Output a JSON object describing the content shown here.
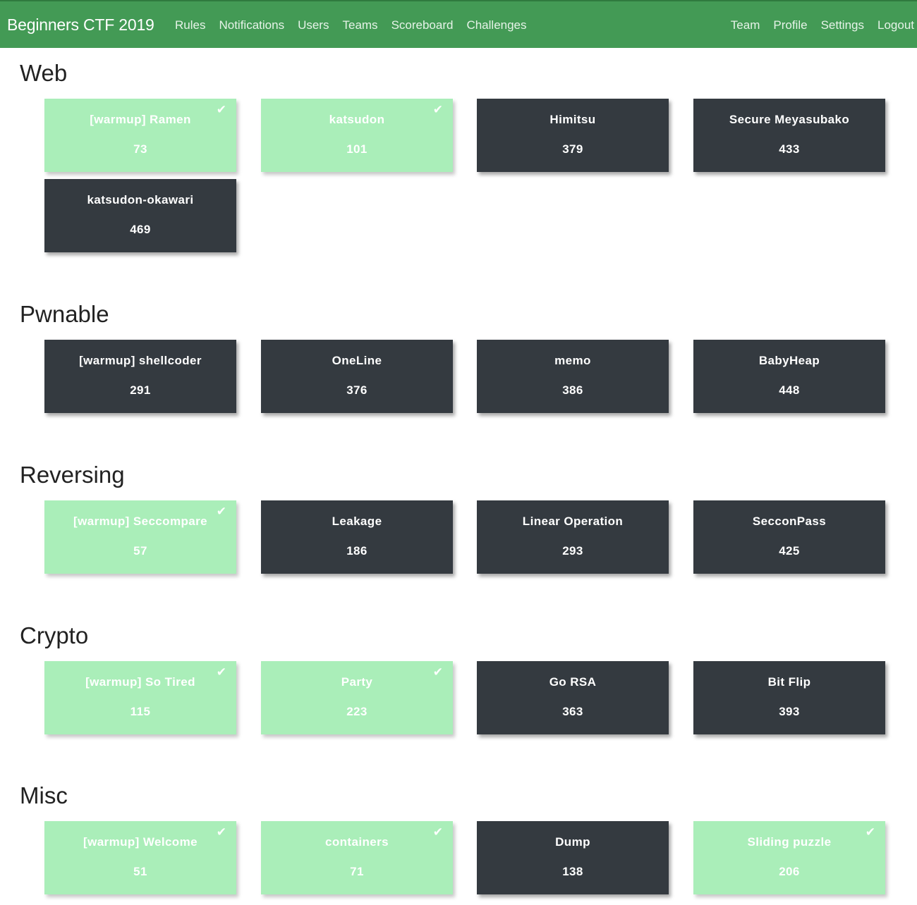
{
  "navbar": {
    "brand": "Beginners CTF 2019",
    "left_links": [
      "Rules",
      "Notifications",
      "Users",
      "Teams",
      "Scoreboard",
      "Challenges"
    ],
    "right_links": [
      "Team",
      "Profile",
      "Settings",
      "Logout"
    ]
  },
  "colors": {
    "navbar": "#439a55",
    "solved": "#aaeeb9",
    "unsolved": "#343a40"
  },
  "categories": [
    {
      "title": "Web",
      "challenges": [
        {
          "name": "[warmup] Ramen",
          "points": "73",
          "solved": true
        },
        {
          "name": "katsudon",
          "points": "101",
          "solved": true
        },
        {
          "name": "Himitsu",
          "points": "379",
          "solved": false
        },
        {
          "name": "Secure Meyasubako",
          "points": "433",
          "solved": false
        },
        {
          "name": "katsudon-okawari",
          "points": "469",
          "solved": false
        }
      ]
    },
    {
      "title": "Pwnable",
      "challenges": [
        {
          "name": "[warmup] shellcoder",
          "points": "291",
          "solved": false
        },
        {
          "name": "OneLine",
          "points": "376",
          "solved": false
        },
        {
          "name": "memo",
          "points": "386",
          "solved": false
        },
        {
          "name": "BabyHeap",
          "points": "448",
          "solved": false
        }
      ]
    },
    {
      "title": "Reversing",
      "challenges": [
        {
          "name": "[warmup] Seccompare",
          "points": "57",
          "solved": true
        },
        {
          "name": "Leakage",
          "points": "186",
          "solved": false
        },
        {
          "name": "Linear Operation",
          "points": "293",
          "solved": false
        },
        {
          "name": "SecconPass",
          "points": "425",
          "solved": false
        }
      ]
    },
    {
      "title": "Crypto",
      "challenges": [
        {
          "name": "[warmup] So Tired",
          "points": "115",
          "solved": true
        },
        {
          "name": "Party",
          "points": "223",
          "solved": true
        },
        {
          "name": "Go RSA",
          "points": "363",
          "solved": false
        },
        {
          "name": "Bit Flip",
          "points": "393",
          "solved": false
        }
      ]
    },
    {
      "title": "Misc",
      "challenges": [
        {
          "name": "[warmup] Welcome",
          "points": "51",
          "solved": true
        },
        {
          "name": "containers",
          "points": "71",
          "solved": true
        },
        {
          "name": "Dump",
          "points": "138",
          "solved": false
        },
        {
          "name": "Sliding puzzle",
          "points": "206",
          "solved": true
        }
      ]
    }
  ]
}
